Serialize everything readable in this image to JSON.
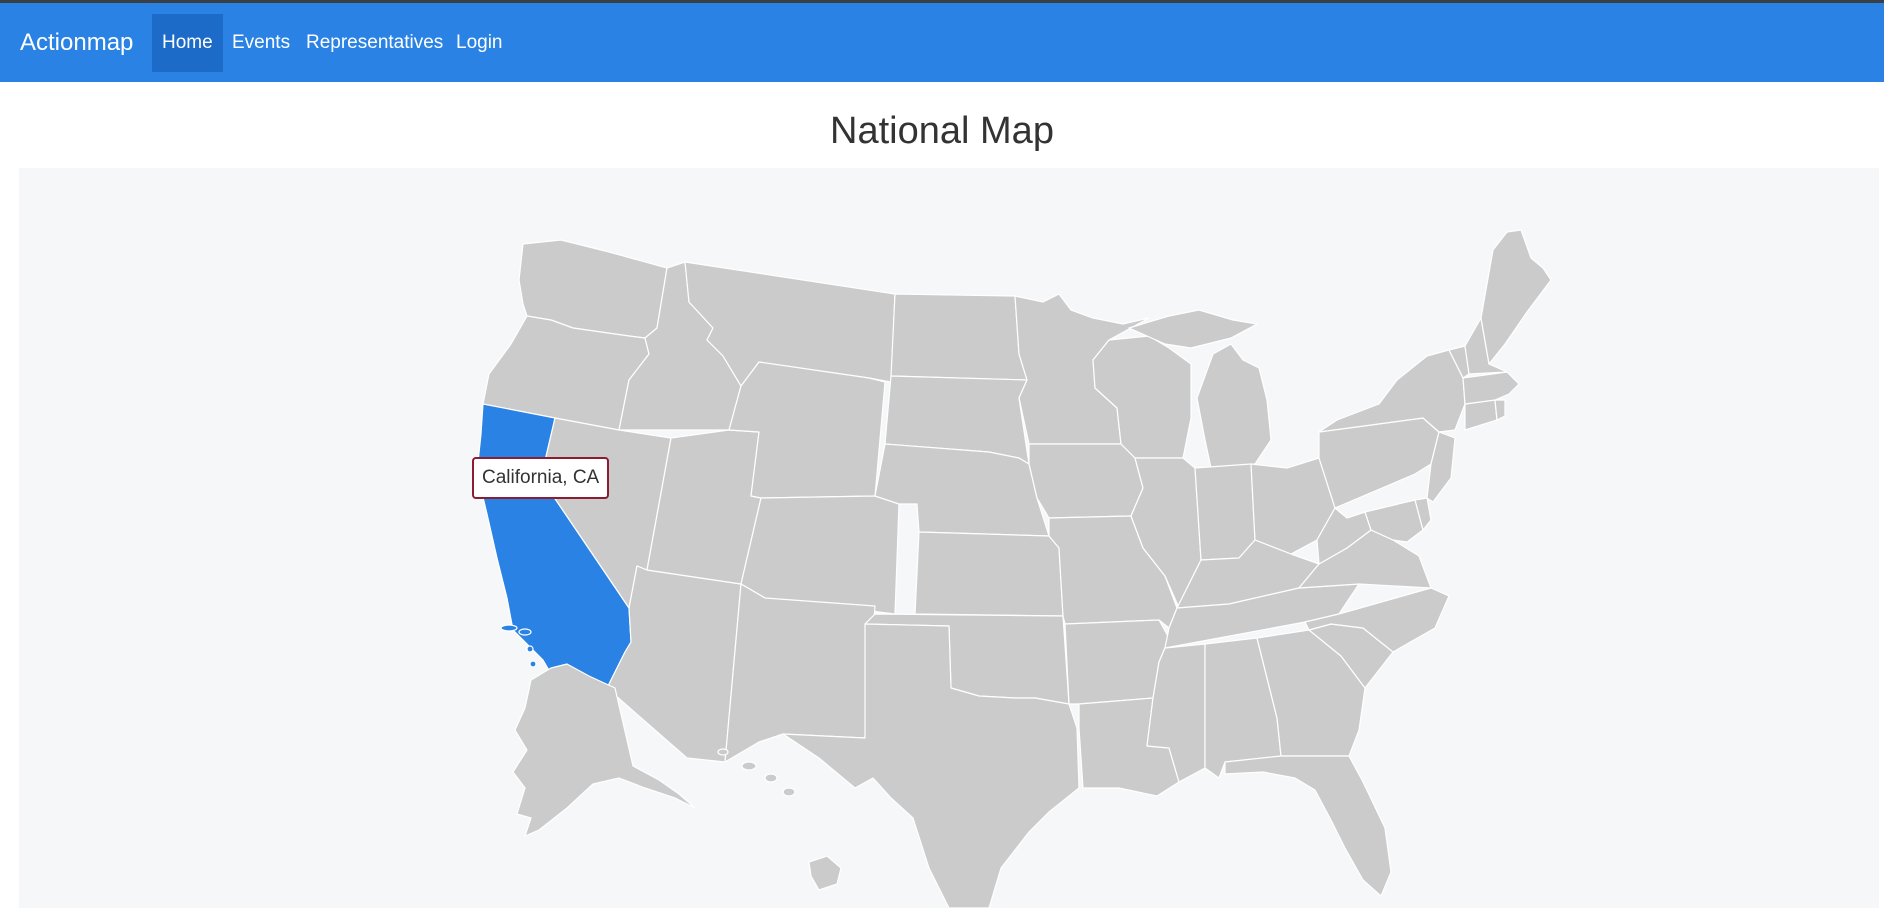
{
  "navbar": {
    "brand": "Actionmap",
    "items": [
      {
        "label": "Home",
        "active": true
      },
      {
        "label": "Events",
        "active": false
      },
      {
        "label": "Representatives",
        "active": false
      },
      {
        "label": "Login",
        "active": false
      }
    ]
  },
  "page": {
    "title": "National Map"
  },
  "map": {
    "highlighted_state": "California",
    "tooltip": "California, CA",
    "highlight_color": "#2a82e4",
    "state_color": "#cbcbcb",
    "tooltip_border_color": "#8b1c32"
  },
  "colors": {
    "navbar": "#2a82e4",
    "navbar_active": "#1c6bc9",
    "map_background": "#f6f7f9"
  }
}
